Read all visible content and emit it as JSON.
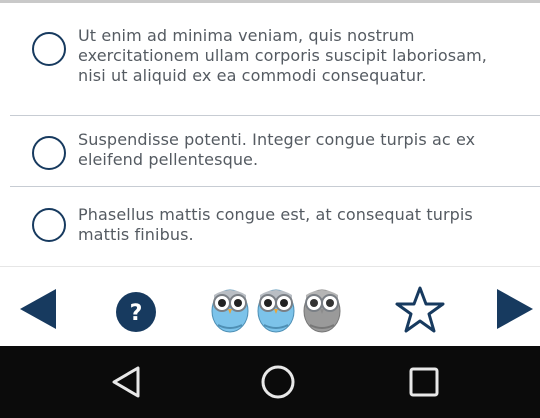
{
  "options": [
    {
      "text": "Ut enim ad minima veniam, quis nostrum exercitationem ullam corporis suscipit laboriosam, nisi ut aliquid ex ea commodi consequatur."
    },
    {
      "text": "Suspendisse potenti. Integer congue turpis ac ex eleifend pellentesque."
    },
    {
      "text": "Phasellus mattis congue est, at consequat turpis mattis finibus."
    }
  ],
  "toolbar": {
    "help_label": "?",
    "prev_icon": "triangle-left-icon",
    "next_icon": "triangle-right-icon",
    "owls": [
      {
        "state": "active",
        "color": "#7cc3ea"
      },
      {
        "state": "active",
        "color": "#7cc3ea"
      },
      {
        "state": "inactive",
        "color": "#9a9a9a"
      }
    ],
    "star_icon": "star-outline-icon"
  },
  "colors": {
    "accent": "#173a5f",
    "text": "#555b62",
    "navbar": "#0b0b0b"
  },
  "navbar": {
    "icons": [
      "back-icon",
      "home-icon",
      "recent-apps-icon"
    ]
  }
}
